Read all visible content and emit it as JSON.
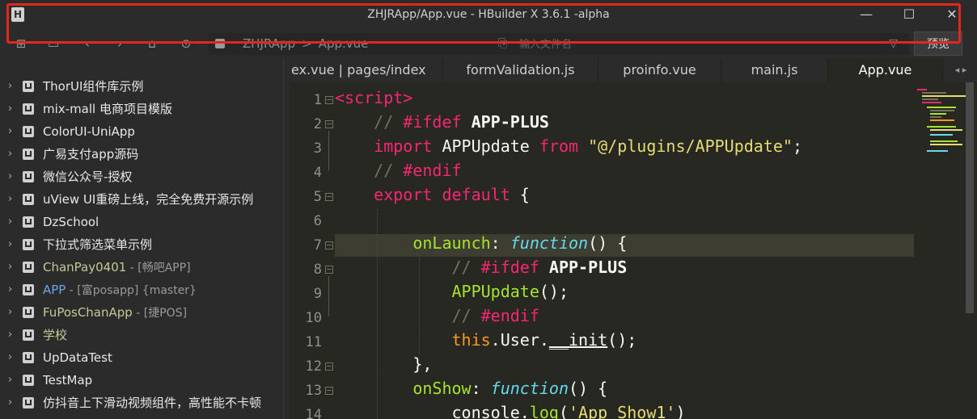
{
  "window": {
    "icon_letter": "H",
    "title": "ZHJRApp/App.vue - HBuilder X 3.6.1 -alpha",
    "minimize": "—",
    "maximize": "☐",
    "close": "✕"
  },
  "toolbar": {
    "path_project": "ZHJRApp",
    "path_separator": ">",
    "path_file": "App.vue",
    "search_placeholder": "输入文件名",
    "preview_label": "预览",
    "icons": [
      "new-file-icon",
      "save-icon",
      "back-icon",
      "forward-icon",
      "home-icon",
      "run-icon"
    ]
  },
  "sidebar": {
    "items": [
      {
        "label": "ThorUI组件库示例",
        "sub": "",
        "color": "#e8e8e8"
      },
      {
        "label": "mix-mall 电商项目模版",
        "sub": "",
        "color": "#e8e8e8"
      },
      {
        "label": "ColorUI-UniApp",
        "sub": "",
        "color": "#e8e8e8"
      },
      {
        "label": "广易支付app源码",
        "sub": "",
        "color": "#e8e8e8"
      },
      {
        "label": "微信公众号-授权",
        "sub": "",
        "color": "#e8e8e8"
      },
      {
        "label": "uView UI重磅上线，完全免费开源示例",
        "sub": "",
        "color": "#e8e8e8"
      },
      {
        "label": "DzSchool",
        "sub": "",
        "color": "#e8e8e8"
      },
      {
        "label": "下拉式筛选菜单示例",
        "sub": "",
        "color": "#e8e8e8"
      },
      {
        "label": "ChanPay0401",
        "sub": " - [畅吧APP]",
        "color": "#c8c896"
      },
      {
        "label": "APP",
        "sub": " - [富posapp] {master}",
        "color": "#6aa6e8"
      },
      {
        "label": "FuPosChanApp",
        "sub": " - [捷POS]",
        "color": "#c8c896"
      },
      {
        "label": "学校",
        "sub": "",
        "color": "#c8c896"
      },
      {
        "label": "UpDataTest",
        "sub": "",
        "color": "#e8e8e8"
      },
      {
        "label": "TestMap",
        "sub": "",
        "color": "#e8e8e8"
      },
      {
        "label": "仿抖音上下滑动视频组件，高性能不卡顿",
        "sub": "",
        "color": "#e8e8e8"
      }
    ]
  },
  "tabs": [
    {
      "label": "ex.vue | pages/index",
      "active": false
    },
    {
      "label": "formValidation.js",
      "active": false
    },
    {
      "label": "proinfo.vue",
      "active": false
    },
    {
      "label": "main.js",
      "active": false
    },
    {
      "label": "App.vue",
      "active": true
    }
  ],
  "tab_arrows": "◂ ▸",
  "editor": {
    "line_numbers": [
      "1",
      "2",
      "3",
      "4",
      "5",
      "6",
      "7",
      "8",
      "9",
      "10",
      "11",
      "12",
      "13",
      "14"
    ],
    "current_line": 7
  },
  "colors": {
    "keyword": "#f92672",
    "comment": "#75715e",
    "string": "#e6db74",
    "function": "#a6e22e",
    "storage": "#66d9ef",
    "highlight_border": "#e0281e"
  }
}
